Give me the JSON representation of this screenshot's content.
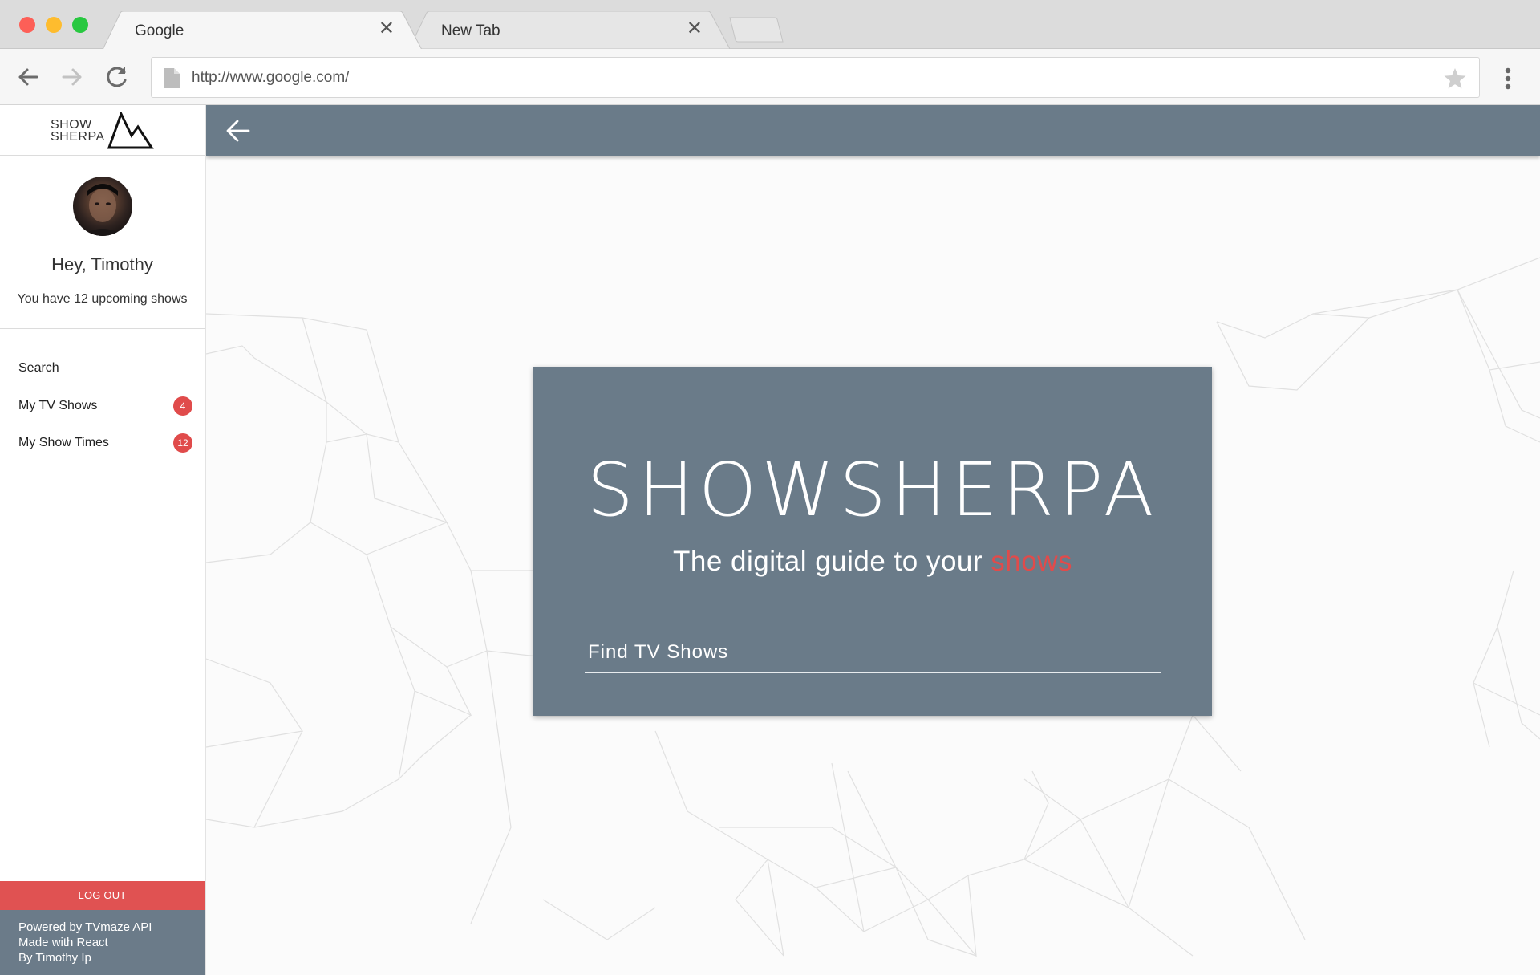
{
  "browser": {
    "tabs": [
      {
        "title": "Google",
        "active": true
      },
      {
        "title": "New Tab",
        "active": false
      }
    ],
    "close_glyph": "✕",
    "url": "http://www.google.com/",
    "icons": {
      "back": "arrow-left-icon",
      "forward": "arrow-right-icon",
      "reload": "reload-icon",
      "page": "page-icon",
      "bookmark": "star-icon",
      "menu": "kebab-menu-icon"
    }
  },
  "sidebar": {
    "logo": {
      "line1": "SHOW",
      "line2": "SHERPA"
    },
    "greeting": "Hey, Timothy",
    "upcoming": "You have 12 upcoming shows",
    "nav": [
      {
        "label": "Search",
        "badge": null
      },
      {
        "label": "My TV Shows",
        "badge": "4"
      },
      {
        "label": "My Show Times",
        "badge": "12"
      }
    ],
    "logout_label": "LOG OUT",
    "footer": [
      "Powered by TVmaze API",
      "Made with React",
      "By Timothy Ip"
    ]
  },
  "header": {
    "back_icon": "arrow-left-icon"
  },
  "hero": {
    "title": "SHOWSHERPA",
    "subtitle_prefix": "The digital guide to your ",
    "subtitle_accent": "shows",
    "search_placeholder": "Find TV Shows"
  },
  "colors": {
    "accent": "#e04b4b",
    "header": "#6a7b89",
    "logout": "#e05252"
  }
}
